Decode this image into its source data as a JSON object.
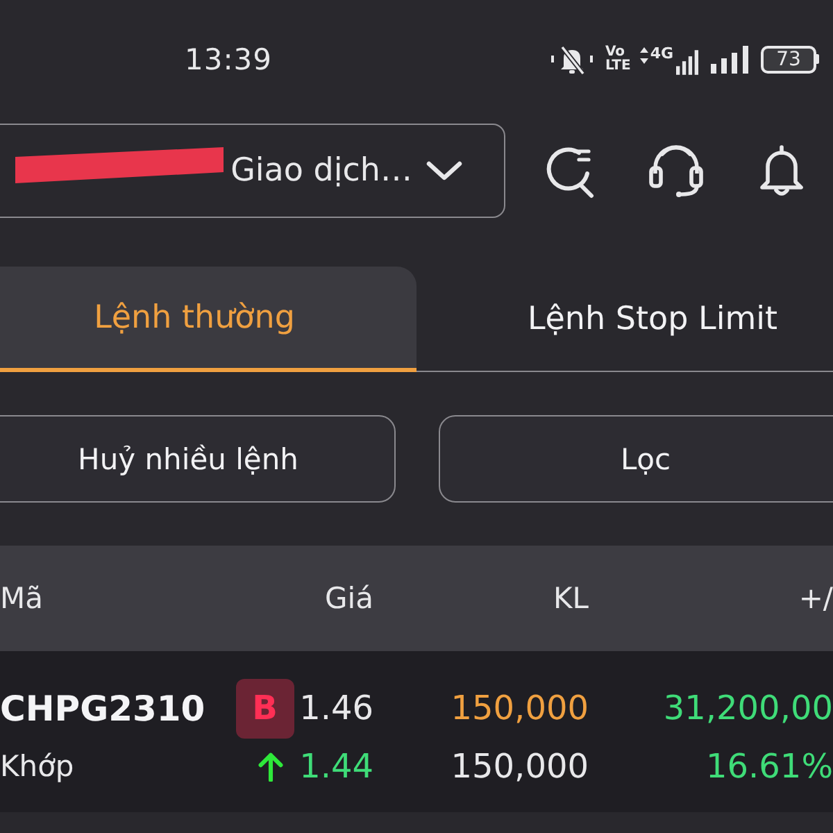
{
  "status_bar": {
    "time": "13:39",
    "volte": [
      "Vo",
      "LTE"
    ],
    "network": "4G",
    "battery": "73"
  },
  "account_select": {
    "value": "Giao dịch…",
    "redacted": true
  },
  "tabs": [
    {
      "label": "Lệnh thường",
      "selected": true
    },
    {
      "label": "Lệnh Stop Limit",
      "selected": false
    }
  ],
  "actions": [
    "Huỷ nhiều lệnh",
    "Lọc"
  ],
  "table": {
    "columns": [
      "Mã",
      "Giá",
      "KL",
      "+/"
    ],
    "rows": [
      {
        "symbol": "CHPG2310",
        "side": "B",
        "price": "1.46",
        "quantity": "150,000",
        "value": "31,200,00",
        "status": "Khớp",
        "rising": true,
        "matched_price": "1.44",
        "matched_quantity": "150,000",
        "change_percent": "16.61%"
      }
    ]
  }
}
